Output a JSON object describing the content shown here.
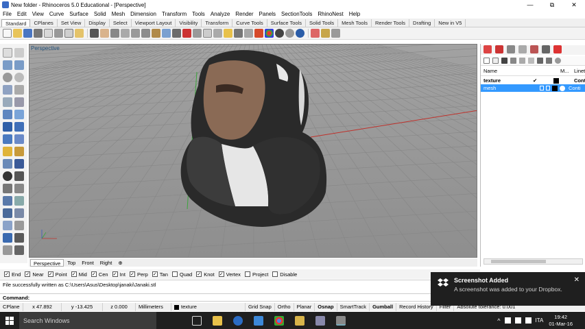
{
  "window": {
    "title": "New folder - Rhinoceros 5.0 Educational - [Perspective]",
    "minimize": "—",
    "maximize": "⧉",
    "close": "✕"
  },
  "menu": [
    "File",
    "Edit",
    "View",
    "Curve",
    "Surface",
    "Solid",
    "Mesh",
    "Dimension",
    "Transform",
    "Tools",
    "Analyze",
    "Render",
    "Panels",
    "SectionTools",
    "RhinoNest",
    "Help"
  ],
  "toolbar_tabs": [
    "Standard",
    "CPlanes",
    "Set View",
    "Display",
    "Select",
    "Viewport Layout",
    "Visibility",
    "Transform",
    "Curve Tools",
    "Surface Tools",
    "Solid Tools",
    "Mesh Tools",
    "Render Tools",
    "Drafting",
    "New in V5"
  ],
  "viewport": {
    "label": "Perspective",
    "tabs": [
      "Perspective",
      "Top",
      "Front",
      "Right"
    ],
    "add_tab": "⊕",
    "axis_label": "z y x"
  },
  "layers_panel": {
    "header_name": "Name",
    "header_material": "M...",
    "header_linetype": "Linet",
    "rows": [
      {
        "name": "texture",
        "check": "✔",
        "linetype": "Cont"
      },
      {
        "name": "mesh",
        "check": "",
        "linetype": "Conti"
      }
    ]
  },
  "osnaps": [
    {
      "label": "End",
      "checked": true
    },
    {
      "label": "Near",
      "checked": true
    },
    {
      "label": "Point",
      "checked": true
    },
    {
      "label": "Mid",
      "checked": true
    },
    {
      "label": "Cen",
      "checked": true
    },
    {
      "label": "Int",
      "checked": true
    },
    {
      "label": "Perp",
      "checked": true
    },
    {
      "label": "Tan",
      "checked": true
    },
    {
      "label": "Quad",
      "checked": false
    },
    {
      "label": "Knot",
      "checked": true
    },
    {
      "label": "Vertex",
      "checked": true
    },
    {
      "label": "Project",
      "checked": false
    },
    {
      "label": "Disable",
      "checked": false
    }
  ],
  "command": {
    "history": "File successfully written as C:\\Users\\Asus\\Desktop\\janaki\\Janaki.stl",
    "prompt": "Command:"
  },
  "statusbar": {
    "cplane": "CPlane",
    "x": "x 47.892",
    "y": "y -13.425",
    "z": "z 0.000",
    "units": "Millimeters",
    "layer": "texture",
    "grid_snap": "Grid Snap",
    "ortho": "Ortho",
    "planar": "Planar",
    "osnap": "Osnap",
    "smarttrack": "SmartTrack",
    "gumball": "Gumball",
    "record_history": "Record History",
    "filter": "Filter",
    "tolerance": "Absolute tolerance: 0.001"
  },
  "taskbar": {
    "search": "Search Windows",
    "lang": "ITA",
    "time": "19:42",
    "date": "01-Mar-16"
  },
  "toast": {
    "title": "Screenshot Added",
    "body": "A screenshot was added to your Dropbox.",
    "close": "✕"
  },
  "colors": {
    "viewport_bg": "#9a9a9a",
    "grid_line": "#8a8a8a",
    "x_axis": "#c0302a",
    "y_axis": "#3aa53a",
    "selection": "#3399ff",
    "taskbar": "#1f1f1f"
  }
}
